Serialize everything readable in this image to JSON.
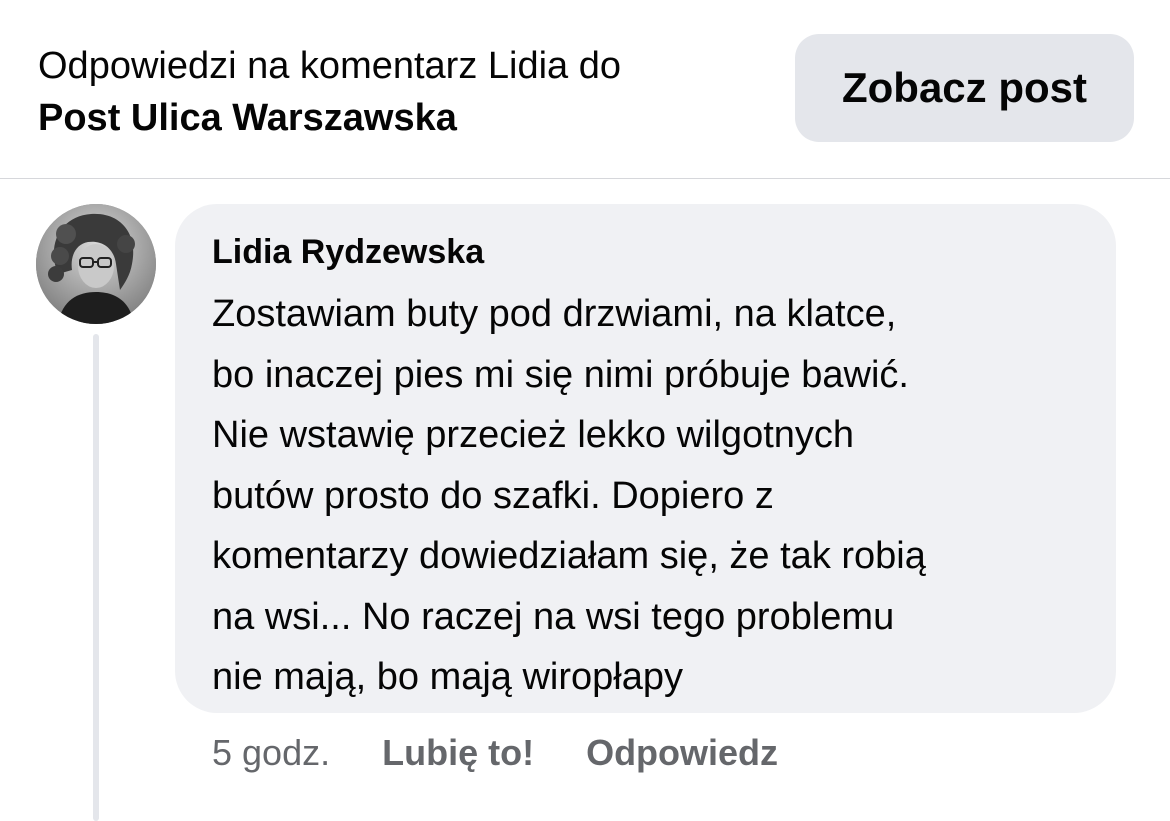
{
  "header": {
    "title_line1": "Odpowiedzi na komentarz Lidia do",
    "title_line2": "Post Ulica Warszawska",
    "view_post_label": "Zobacz post"
  },
  "comment": {
    "author": "Lidia Rydzewska",
    "text": "Zostawiam buty pod drzwiami, na klatce,\nbo inaczej pies mi się nimi próbuje bawić.\nNie wstawię przecież lekko wilgotnych\nbutów prosto do szafki. Dopiero z\nkomentarzy dowiedziałam się, że tak robią\nna wsi... No raczej na wsi tego problemu\nnie mają, bo mają wiropłapy",
    "time": "5 godz.",
    "like_label": "Lubię to!",
    "reply_label": "Odpowiedz"
  },
  "colors": {
    "bubble": "#f0f1f4",
    "button": "#e4e6eb",
    "secondary_text": "#65676b",
    "primary_text": "#050505"
  }
}
